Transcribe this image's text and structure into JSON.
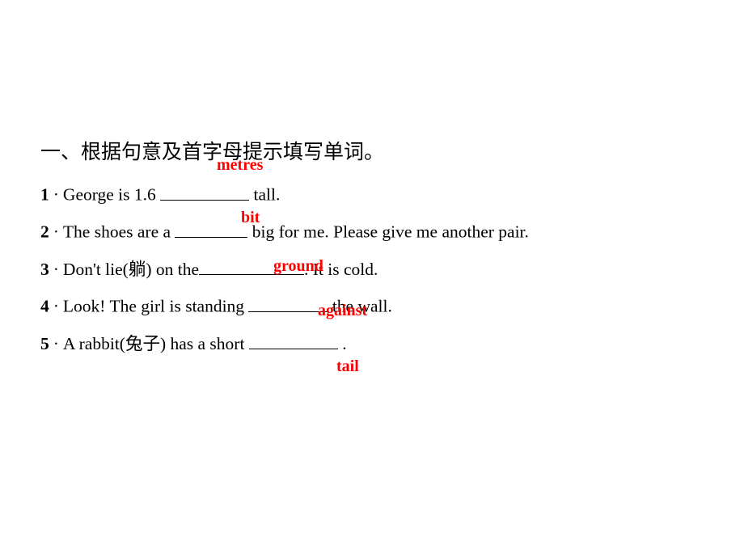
{
  "slide": {
    "heading": "一、根据句意及首字母提示填写单词。",
    "questions": [
      {
        "num": "1",
        "sep": "·",
        "before": "George is  1.6 ",
        "blank_width": 110,
        "after": " tall.",
        "answer": "metres"
      },
      {
        "num": "2",
        "sep": "·",
        "before": "The shoes are a ",
        "blank_width": 90,
        "after": " big for me. Please give  me another pair.",
        "answer": "bit"
      },
      {
        "num": "3",
        "sep": "·",
        "before": "Don't lie(躺) on the",
        "blank_width": 130,
        "after": ". It is cold.",
        "answer": "ground"
      },
      {
        "num": "4",
        "sep": "·",
        "before": "Look! The girl  is standing ",
        "blank_width": 98,
        "after": " the wall.",
        "answer": "against"
      },
      {
        "num": "5",
        "sep": "·",
        "before": "A rabbit(兔子) has a short ",
        "blank_width": 110,
        "after": " .",
        "answer": "tail"
      }
    ]
  },
  "colors": {
    "answer": "#ff0000",
    "text": "#000000",
    "background": "#ffffff"
  }
}
